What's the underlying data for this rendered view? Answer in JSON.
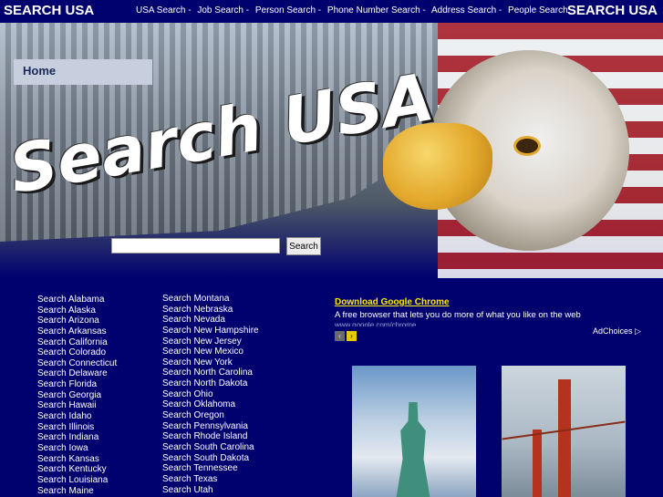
{
  "brand_left": "SEARCH USA",
  "brand_right": "SEARCH USA",
  "top_nav": [
    "USA Search -",
    "Job Search -",
    "Person Search -",
    "Phone Number Search -",
    "Address Search -",
    "People Search"
  ],
  "home_tab": "Home",
  "hero_title": "Search USA",
  "search": {
    "value": "",
    "button": "Search"
  },
  "states_col1": [
    "Search Alabama",
    "Search Alaska",
    "Search Arizona",
    "Search Arkansas",
    "Search California",
    "Search Colorado",
    "Search Connecticut",
    "Search Delaware",
    "Search Florida",
    "Search Georgia",
    "Search Hawaii",
    "Search Idaho",
    "Search Illinois",
    "Search Indiana",
    "Search Iowa",
    "Search Kansas",
    "Search Kentucky",
    "Search Louisiana",
    "Search Maine"
  ],
  "states_col2": [
    "Search Montana",
    "Search Nebraska",
    "Search Nevada",
    "Search New Hampshire",
    "Search New Jersey",
    "Search New Mexico",
    "Search New York",
    "Search North Carolina",
    "Search North Dakota",
    "Search Ohio",
    "Search Oklahoma",
    "Search Oregon",
    "Search Pennsylvania",
    "Search Rhode Island",
    "Search South Carolina",
    "Search South Dakota",
    "Search Tennessee",
    "Search Texas",
    "Search Utah"
  ],
  "ad": {
    "title": "Download Google Chrome",
    "description": "A free browser that lets you do more of what you like on the web",
    "url": "www.google.com/chrome",
    "adchoices": "AdChoices ▷",
    "prev_icon": "chevron-left-icon",
    "next_icon": "chevron-right-icon"
  },
  "colors": {
    "background": "#00006e",
    "ad_title": "#ffea00"
  }
}
